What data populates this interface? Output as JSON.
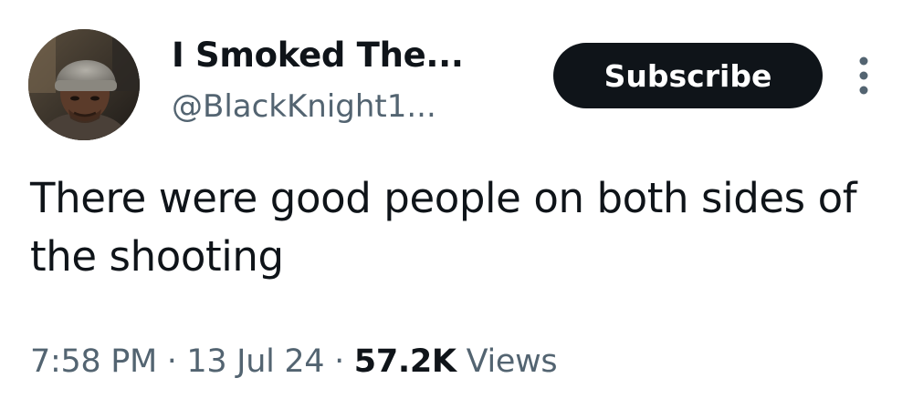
{
  "author": {
    "display_name": "I Smoked The...",
    "handle": "@BlackKnight1..."
  },
  "actions": {
    "subscribe_label": "Subscribe",
    "more_icon": "more-vertical-icon"
  },
  "tweet": {
    "text": "There were good people on both sides of the shooting",
    "time": "7:58 PM",
    "date": "13 Jul 24",
    "views_count": "57.2K",
    "views_label": "Views",
    "separator": "·"
  }
}
